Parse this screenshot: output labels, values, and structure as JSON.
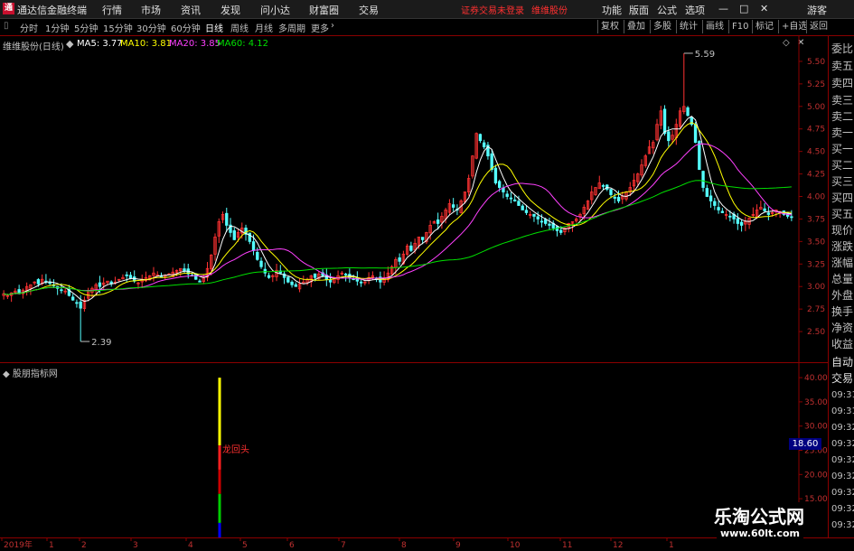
{
  "app": {
    "logo": "通",
    "title": "通达信金融终端"
  },
  "menu": [
    "行情",
    "市场",
    "资讯",
    "发现",
    "问小达",
    "财富圈",
    "交易"
  ],
  "warning": "证券交易未登录",
  "stock_short": "维维股份",
  "right_menu": [
    "功能",
    "版面",
    "公式",
    "选项"
  ],
  "window_buttons": {
    "min": "—",
    "max": "□",
    "close": "✕",
    "guest": "游客"
  },
  "periods": [
    "分时",
    "1分钟",
    "5分钟",
    "15分钟",
    "30分钟",
    "60分钟",
    "日线",
    "周线",
    "月线",
    "多周期",
    "更多"
  ],
  "active_period": "日线",
  "tools": [
    "复权",
    "叠加",
    "多股",
    "统计",
    "画线",
    "F10",
    "标记",
    "+自选",
    "返回"
  ],
  "main_title": "维维股份(日线)",
  "ma_legend": [
    {
      "label": "MA5: 3.77",
      "color": "#ffffff"
    },
    {
      "label": "MA10: 3.81",
      "color": "#ffff00"
    },
    {
      "label": "MA20: 3.85",
      "color": "#ff40ff"
    },
    {
      "label": "MA60: 4.12",
      "color": "#00e000"
    }
  ],
  "sub_title": "股朋指标网",
  "sub_label": "龙回头",
  "side_panel": [
    "委比",
    "卖五",
    "卖四",
    "卖三",
    "卖二",
    "卖一",
    "买一",
    "买二",
    "买三",
    "买四",
    "买五",
    "现价",
    "涨跌",
    "涨幅",
    "总量",
    "外盘",
    "换手",
    "净资",
    "收益",
    "自动",
    "交易"
  ],
  "side_times": [
    "09:31",
    "09:31",
    "09:32",
    "09:32",
    "09:32",
    "09:32",
    "09:32",
    "09:32",
    "09:32"
  ],
  "price_badge": "18.60",
  "watermark": {
    "cn": "乐淘公式网",
    "url": "www.60lt.com"
  },
  "chart_data": {
    "type": "candlestick",
    "y_ticks": [
      2.5,
      2.75,
      3.0,
      3.25,
      3.5,
      3.75,
      4.0,
      4.25,
      4.5,
      4.75,
      5.0,
      5.25,
      5.5
    ],
    "ylim": [
      2.25,
      5.7
    ],
    "annotations": [
      {
        "text": "5.59",
        "value": 5.59
      },
      {
        "text": "2.39",
        "value": 2.39
      }
    ],
    "x_labels": [
      "2019年",
      "1",
      "2",
      "3",
      "4",
      "5",
      "6",
      "7",
      "8",
      "9",
      "10",
      "11",
      "12",
      "1"
    ],
    "close": [
      2.92,
      2.9,
      2.93,
      2.95,
      2.92,
      2.96,
      3.0,
      3.02,
      3.05,
      3.03,
      3.08,
      3.06,
      3.04,
      3.01,
      2.98,
      2.96,
      2.95,
      2.9,
      2.85,
      2.82,
      2.76,
      2.85,
      2.95,
      2.98,
      3.02,
      3.0,
      3.04,
      3.06,
      3.03,
      3.05,
      3.08,
      3.1,
      3.12,
      3.09,
      3.06,
      3.04,
      3.08,
      3.1,
      3.12,
      3.15,
      3.13,
      3.11,
      3.12,
      3.14,
      3.16,
      3.18,
      3.2,
      3.17,
      3.14,
      3.12,
      3.08,
      3.05,
      3.1,
      3.2,
      3.35,
      3.55,
      3.72,
      3.8,
      3.68,
      3.6,
      3.52,
      3.6,
      3.65,
      3.58,
      3.5,
      3.4,
      3.3,
      3.22,
      3.15,
      3.1,
      3.12,
      3.18,
      3.15,
      3.1,
      3.05,
      3.02,
      3.0,
      3.03,
      3.05,
      3.08,
      3.12,
      3.1,
      3.14,
      3.12,
      3.08,
      3.05,
      3.1,
      3.12,
      3.15,
      3.13,
      3.1,
      3.08,
      3.06,
      3.04,
      3.05,
      3.1,
      3.12,
      3.08,
      3.05,
      3.1,
      3.15,
      3.22,
      3.3,
      3.28,
      3.36,
      3.45,
      3.4,
      3.48,
      3.55,
      3.52,
      3.6,
      3.68,
      3.72,
      3.7,
      3.78,
      3.85,
      3.92,
      3.88,
      3.85,
      3.95,
      4.05,
      4.2,
      4.45,
      4.7,
      4.62,
      4.55,
      4.45,
      4.3,
      4.15,
      4.1,
      4.05,
      4.0,
      3.98,
      3.95,
      3.9,
      3.85,
      3.82,
      3.8,
      3.78,
      3.75,
      3.72,
      3.7,
      3.68,
      3.65,
      3.62,
      3.6,
      3.65,
      3.7,
      3.72,
      3.75,
      3.8,
      3.88,
      3.95,
      4.05,
      4.1,
      4.15,
      4.12,
      4.08,
      4.02,
      3.98,
      3.95,
      4.0,
      4.05,
      4.1,
      4.18,
      4.25,
      4.35,
      4.45,
      4.55,
      4.6,
      4.8,
      4.95,
      4.7,
      4.62,
      4.68,
      4.8,
      4.95,
      5.0,
      4.9,
      4.8,
      4.6,
      4.3,
      4.1,
      4.0,
      3.95,
      3.9,
      3.85,
      3.82,
      3.8,
      3.78,
      3.75,
      3.7,
      3.68,
      3.72,
      3.76,
      3.8,
      3.85,
      3.88,
      3.84,
      3.8,
      3.82,
      3.85,
      3.83,
      3.8,
      3.78,
      3.77
    ]
  },
  "sub_chart": {
    "y_ticks": [
      15.0,
      20.0,
      25.0,
      30.0,
      35.0,
      40.0
    ],
    "ylim": [
      7.0,
      43.0
    ],
    "segments": [
      {
        "from": 40.0,
        "to": 26.0,
        "color": "#ffff00"
      },
      {
        "from": 26.0,
        "to": 21.0,
        "color": "#ff2020"
      },
      {
        "from": 21.0,
        "to": 16.0,
        "color": "#cc0000"
      },
      {
        "from": 16.0,
        "to": 10.0,
        "color": "#00cc00"
      },
      {
        "from": 10.0,
        "to": 6.0,
        "color": "#0000ff"
      }
    ]
  }
}
